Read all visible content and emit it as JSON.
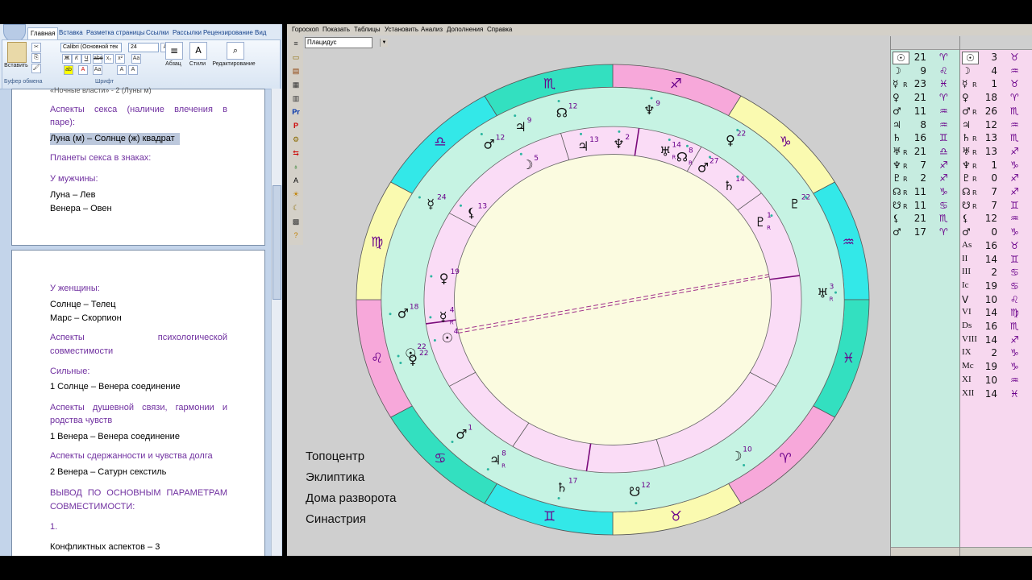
{
  "word": {
    "tabs": [
      "Главная",
      "Вставка",
      "Разметка страницы",
      "Ссылки",
      "Рассылки",
      "Рецензирование",
      "Вид"
    ],
    "paste_label": "Вставить",
    "clipboard_label": "Буфер обмена",
    "font_name": "Calibri (Основной тек",
    "font_size": "24",
    "font_group_label": "Шрифт",
    "paragraph_label": "Абзац",
    "styles_label": "Стили",
    "editing_label": "Редактирование",
    "page1_top_cut": "«Ночные власти» - 2 (Луны м)",
    "page1": [
      {
        "text": "Аспекты секса (наличие влечения в",
        "kind": "heading"
      },
      {
        "text": "паре):",
        "kind": "heading"
      },
      {
        "text": "Луна (м) – Солнце (ж) квадрат",
        "kind": "selected"
      },
      {
        "text": "Планеты секса в знаках:",
        "kind": "heading"
      },
      {
        "text": "У мужчины:",
        "kind": "heading"
      },
      {
        "text": "Луна – Лев",
        "kind": "text"
      },
      {
        "text": "Венера – Овен",
        "kind": "text"
      }
    ],
    "page2": [
      {
        "text": "У женщины:",
        "kind": "heading"
      },
      {
        "text": "Солнце – Телец",
        "kind": "text"
      },
      {
        "text": "Марс – Скорпион",
        "kind": "text"
      },
      {
        "text": "Аспекты психологической",
        "kind": "heading"
      },
      {
        "text": "совместимости",
        "kind": "heading"
      },
      {
        "text": "Сильные:",
        "kind": "heading"
      },
      {
        "text": "1 Солнце – Венера соединение",
        "kind": "text"
      },
      {
        "text": "Аспекты душевной связи, гармонии и",
        "kind": "heading"
      },
      {
        "text": "родства чувств",
        "kind": "heading"
      },
      {
        "text": "1 Венера – Венера соединение",
        "kind": "text"
      },
      {
        "text": "Аспекты сдержанности и чувства долга",
        "kind": "heading"
      },
      {
        "text": "2 Венера – Сатурн секстиль",
        "kind": "text"
      },
      {
        "text": "ВЫВОД ПО ОСНОВНЫМ ПАРАМЕТРАМ",
        "kind": "heading"
      },
      {
        "text": "СОВМЕСТИМОСТИ:",
        "kind": "heading"
      },
      {
        "text": "1.",
        "kind": "heading"
      },
      {
        "text": "Конфликтных аспектов – 3",
        "kind": "text"
      }
    ]
  },
  "astro": {
    "menu": [
      "Гороскоп",
      "Показать",
      "Таблицы",
      "Установить",
      "Анализ",
      "Дополнения",
      "Справка"
    ],
    "house_system": "Плацидус",
    "tools": [
      "≡",
      "▭",
      "▤",
      "▦",
      "▥",
      "Pr",
      "P",
      "⚙",
      "⇆",
      "♁",
      "A",
      "☀",
      "☾",
      "▩",
      "?"
    ],
    "legend": [
      "Топоцентр",
      "Эклиптика",
      "Дома разворота",
      "Синастрия"
    ],
    "colors": {
      "fire": "#f7a8da",
      "earth": "#fafab0",
      "air": "#33e8e8",
      "water": "#33e0c0",
      "ring": "#c6f3e3",
      "houses": "#fadcf6",
      "center": "#fbfbe0",
      "glyph": "#6a008a"
    },
    "zodiac_ring": [
      "♐",
      "♑",
      "♒",
      "♓",
      "♈",
      "♉",
      "♊",
      "♋",
      "♌",
      "♍",
      "♎",
      "♏"
    ],
    "outer_planets": [
      {
        "glyph": "☊",
        "deg": "12",
        "r": ""
      },
      {
        "glyph": "♆",
        "deg": "9",
        "r": ""
      },
      {
        "glyph": "♀",
        "deg": "22",
        "r": ""
      },
      {
        "glyph": "♇",
        "deg": "22",
        "r": ""
      },
      {
        "glyph": "♅",
        "deg": "3",
        "r": "R"
      },
      {
        "glyph": "☽",
        "deg": "10",
        "r": ""
      },
      {
        "glyph": "☋",
        "deg": "12",
        "r": ""
      },
      {
        "glyph": "♄",
        "deg": "17",
        "r": ""
      },
      {
        "glyph": "♃",
        "deg": "8",
        "r": "R"
      },
      {
        "glyph": "♂",
        "deg": "1",
        "r": ""
      },
      {
        "glyph": "☉",
        "deg": "22",
        "r": ""
      },
      {
        "glyph": "♀",
        "deg": "22",
        "r": ""
      },
      {
        "glyph": "♂",
        "deg": "18",
        "r": ""
      },
      {
        "glyph": "☿",
        "deg": "24",
        "r": ""
      },
      {
        "glyph": "♂",
        "deg": "12",
        "r": ""
      },
      {
        "glyph": "♃",
        "deg": "9",
        "r": ""
      }
    ],
    "inner_planets": [
      {
        "glyph": "♃",
        "deg": "13",
        "r": ""
      },
      {
        "glyph": "♆",
        "deg": "2",
        "r": ""
      },
      {
        "glyph": "♅",
        "deg": "14",
        "r": "R"
      },
      {
        "glyph": "☊",
        "deg": "8",
        "r": "R"
      },
      {
        "glyph": "♂",
        "deg": "27",
        "r": ""
      },
      {
        "glyph": "♄",
        "deg": "14",
        "r": ""
      },
      {
        "glyph": "♇",
        "deg": "1",
        "r": "R"
      },
      {
        "glyph": "☽",
        "deg": "5",
        "r": ""
      },
      {
        "glyph": "⚸",
        "deg": "13",
        "r": ""
      },
      {
        "glyph": "♀",
        "deg": "19",
        "r": ""
      },
      {
        "glyph": "☿",
        "deg": "4",
        "r": "R"
      },
      {
        "glyph": "☉",
        "deg": "4",
        "r": ""
      }
    ],
    "table1": [
      [
        "☉",
        "",
        "21",
        "♈"
      ],
      [
        "☽",
        "",
        "9",
        "♌"
      ],
      [
        "☿",
        "R",
        "23",
        "♓"
      ],
      [
        "♀",
        "",
        "21",
        "♈"
      ],
      [
        "♂",
        "",
        "11",
        "♒"
      ],
      [
        "♃",
        "",
        "8",
        "♒"
      ],
      [
        "♄",
        "",
        "16",
        "♊"
      ],
      [
        "♅",
        "R",
        "21",
        "♎"
      ],
      [
        "♆",
        "R",
        "7",
        "♐"
      ],
      [
        "♇",
        "R",
        "2",
        "♐"
      ],
      [
        "☊",
        "R",
        "11",
        "♑"
      ],
      [
        "☋",
        "R",
        "11",
        "♋"
      ],
      [
        "⚸",
        "",
        "21",
        "♏"
      ],
      [
        "♂",
        "",
        "17",
        "♈"
      ]
    ],
    "table2": [
      [
        "☉",
        "",
        "3",
        "♉"
      ],
      [
        "☽",
        "",
        "4",
        "♒"
      ],
      [
        "☿",
        "R",
        "1",
        "♉"
      ],
      [
        "♀",
        "",
        "18",
        "♈"
      ],
      [
        "♂",
        "R",
        "26",
        "♏"
      ],
      [
        "♃",
        "",
        "12",
        "♒"
      ],
      [
        "♄",
        "R",
        "13",
        "♏"
      ],
      [
        "♅",
        "R",
        "13",
        "♐"
      ],
      [
        "♆",
        "R",
        "1",
        "♑"
      ],
      [
        "♇",
        "R",
        "0",
        "♐"
      ],
      [
        "☊",
        "R",
        "7",
        "♐"
      ],
      [
        "☋",
        "R",
        "7",
        "♊"
      ],
      [
        "⚸",
        "",
        "12",
        "♒"
      ],
      [
        "♂",
        "",
        "0",
        "♑"
      ],
      [
        "As",
        "",
        "16",
        "♉"
      ],
      [
        "II",
        "",
        "14",
        "♊"
      ],
      [
        "III",
        "",
        "2",
        "♋"
      ],
      [
        "Ic",
        "",
        "19",
        "♋"
      ],
      [
        "V",
        "",
        "10",
        "♌"
      ],
      [
        "VI",
        "",
        "14",
        "♍"
      ],
      [
        "Ds",
        "",
        "16",
        "♏"
      ],
      [
        "VIII",
        "",
        "14",
        "♐"
      ],
      [
        "IX",
        "",
        "2",
        "♑"
      ],
      [
        "Mc",
        "",
        "19",
        "♑"
      ],
      [
        "XI",
        "",
        "10",
        "♒"
      ],
      [
        "XII",
        "",
        "14",
        "♓"
      ]
    ]
  }
}
